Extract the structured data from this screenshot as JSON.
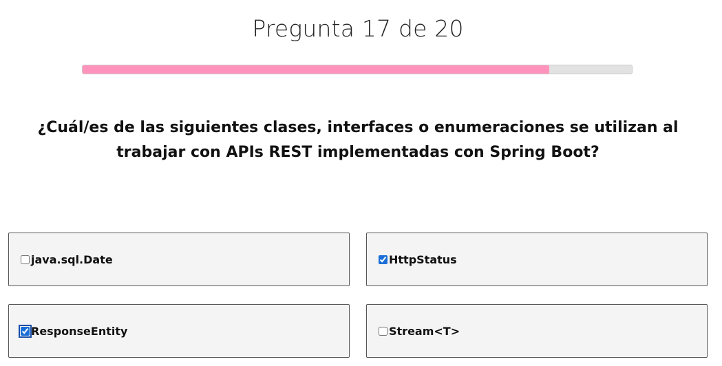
{
  "header": {
    "title": "Pregunta 17 de 20"
  },
  "progress": {
    "current": 17,
    "total": 20,
    "fraction": 0.85,
    "fill_color": "#ff93bb",
    "track_color": "#e2e2e2"
  },
  "question": {
    "text": "¿Cuál/es de las siguientes clases, interfaces o enumeraciones se utilizan al trabajar con APIs REST implementadas con Spring Boot?"
  },
  "options": [
    {
      "label": "java.sql.Date",
      "checked": false
    },
    {
      "label": "HttpStatus",
      "checked": true
    },
    {
      "label": "ResponseEntity",
      "checked": true,
      "focused": true
    },
    {
      "label": "Stream<T>",
      "checked": false
    }
  ]
}
